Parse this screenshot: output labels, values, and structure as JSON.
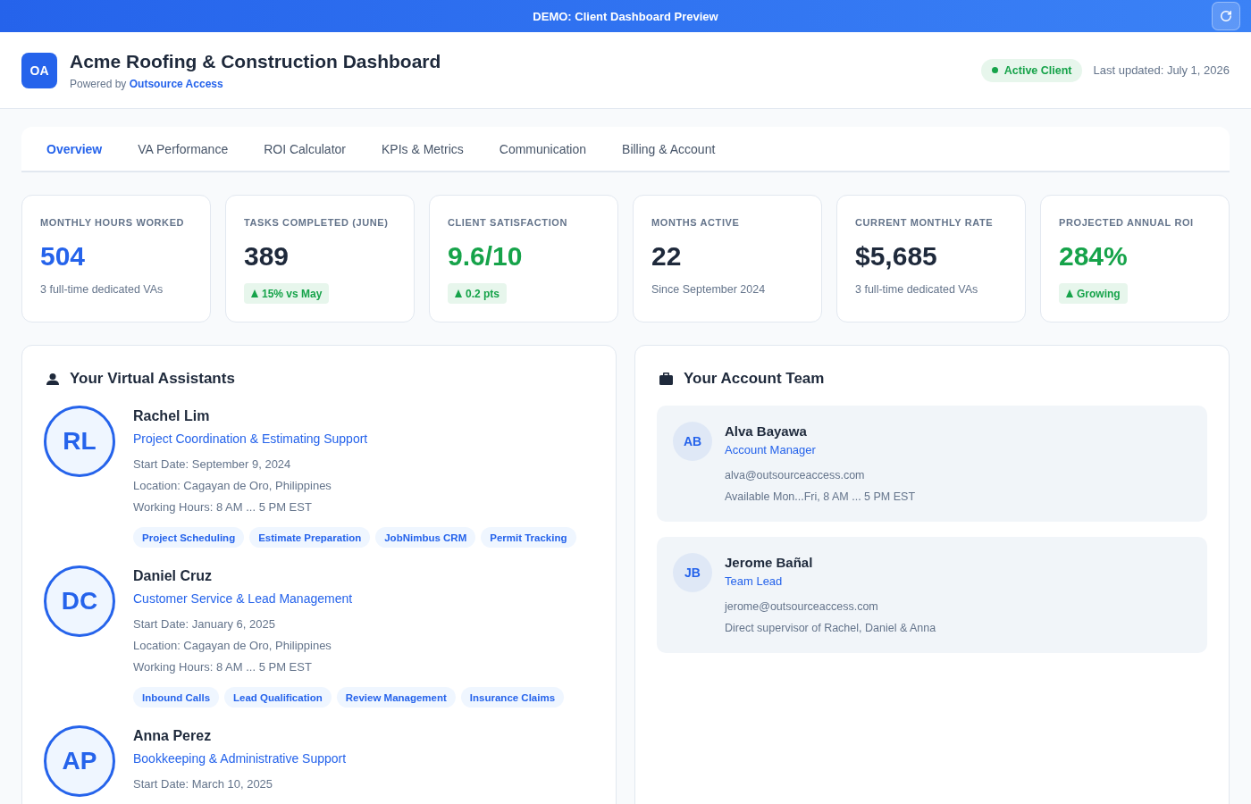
{
  "banner": {
    "title": "DEMO: Client Dashboard Preview"
  },
  "header": {
    "logo": "OA",
    "title": "Acme Roofing & Construction Dashboard",
    "powered_by": {
      "prefix": "Powered by",
      "link": "Outsource Access"
    },
    "status": "Active Client",
    "last_updated": "Last updated: July 1, 2026"
  },
  "tabs": [
    {
      "label": "Overview",
      "selected": true
    },
    {
      "label": "VA Performance",
      "selected": false
    },
    {
      "label": "ROI Calculator",
      "selected": false
    },
    {
      "label": "KPIs & Metrics",
      "selected": false
    },
    {
      "label": "Communication",
      "selected": false
    },
    {
      "label": "Billing & Account",
      "selected": false
    }
  ],
  "kpis": [
    {
      "label": "MONTHLY HOURS WORKED",
      "value": "504",
      "color": "#2563eb",
      "kind": "note",
      "note": "3 full-time dedicated VAs"
    },
    {
      "label": "TASKS COMPLETED (JUNE)",
      "value": "389",
      "color": "#1e293b",
      "kind": "trend",
      "note": "15% vs May"
    },
    {
      "label": "CLIENT SATISFACTION",
      "value": "9.6/10",
      "color": "#16a34a",
      "kind": "trend",
      "note": "0.2 pts"
    },
    {
      "label": "MONTHS ACTIVE",
      "value": "22",
      "color": "#1e293b",
      "kind": "note",
      "note": "Since September 2024"
    },
    {
      "label": "CURRENT MONTHLY RATE",
      "value": "$5,685",
      "color": "#1e293b",
      "kind": "note",
      "note": "3 full-time dedicated VAs"
    },
    {
      "label": "PROJECTED ANNUAL ROI",
      "value": "284%",
      "color": "#16a34a",
      "kind": "trend",
      "note": "Growing"
    }
  ],
  "assistants_panel": {
    "title": "Your Virtual Assistants",
    "assistants": [
      {
        "initials": "RL",
        "name": "Rachel Lim",
        "role": "Project Coordination & Estimating Support",
        "details": [
          "Start Date: September 9, 2024",
          "Location: Cagayan de Oro, Philippines",
          "Working Hours: 8 AM ... 5 PM EST"
        ],
        "skills": [
          "Project Scheduling",
          "Estimate Preparation",
          "JobNimbus CRM",
          "Permit Tracking"
        ]
      },
      {
        "initials": "DC",
        "name": "Daniel Cruz",
        "role": "Customer Service & Lead Management",
        "details": [
          "Start Date: January 6, 2025",
          "Location: Cagayan de Oro, Philippines",
          "Working Hours: 8 AM ... 5 PM EST"
        ],
        "skills": [
          "Inbound Calls",
          "Lead Qualification",
          "Review Management",
          "Insurance Claims"
        ]
      },
      {
        "initials": "AP",
        "name": "Anna Perez",
        "role": "Bookkeeping & Administrative Support",
        "details": [
          "Start Date: March 10, 2025"
        ]
      }
    ]
  },
  "team_panel": {
    "title": "Your Account Team",
    "members": [
      {
        "initials": "AB",
        "name": "Alva Bayawa",
        "role": "Account Manager",
        "email": "alva@outsourceaccess.com",
        "note": "Available Mon...Fri, 8 AM ... 5 PM EST"
      },
      {
        "initials": "JB",
        "name": "Jerome Bañal",
        "role": "Team Lead",
        "email": "jerome@outsourceaccess.com",
        "note": "Direct supervisor of Rachel, Daniel & Anna"
      }
    ]
  }
}
